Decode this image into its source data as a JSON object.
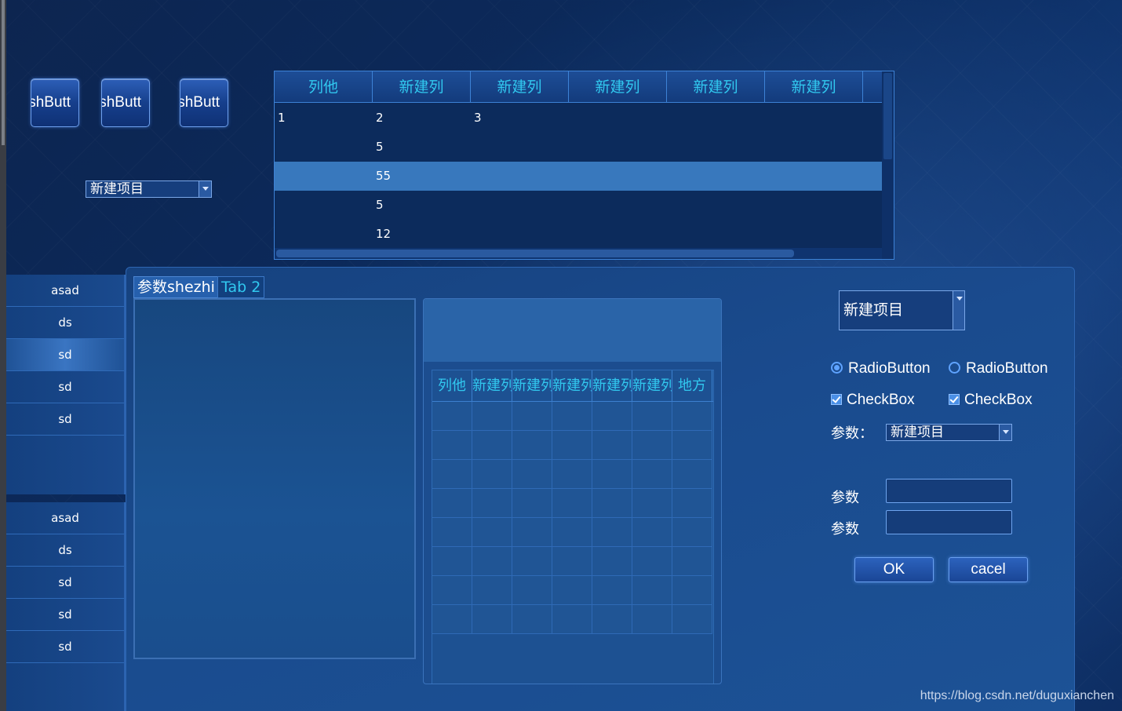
{
  "push_buttons": [
    "ishButt",
    "ishButt",
    "ishButt"
  ],
  "top_combo": {
    "value": "新建项目"
  },
  "top_table": {
    "headers": [
      "列他",
      "新建列",
      "新建列",
      "新建列",
      "新建列",
      "新建列"
    ],
    "rows": [
      [
        "1",
        "2",
        "3"
      ],
      [
        "",
        "5",
        ""
      ],
      [
        "",
        "55",
        ""
      ],
      [
        "",
        "5",
        ""
      ],
      [
        "",
        "12",
        ""
      ]
    ],
    "selected_row": 2
  },
  "nav_top": {
    "items": [
      "asad",
      "ds",
      "sd",
      "sd",
      "sd"
    ],
    "active": 2
  },
  "nav_bottom": {
    "items": [
      "asad",
      "ds",
      "sd",
      "sd",
      "sd"
    ]
  },
  "tabs": [
    "参数shezhi",
    "Tab 2"
  ],
  "grid": {
    "headers": [
      "列他",
      "新建列",
      "新建列",
      "新建列",
      "新建列",
      "新建列",
      "地方"
    ],
    "row_count": 8
  },
  "settings": {
    "combo_value": "新建项目",
    "radio1": "RadioButton",
    "radio2": "RadioButton",
    "check1": "CheckBox",
    "check2": "CheckBox",
    "param_label_colon": "参数：",
    "param_combo_value": "新建项目",
    "param_label1": "参数",
    "param_label2": "参数",
    "ok": "OK",
    "cancel": "cacel"
  },
  "watermark": "https://blog.csdn.net/duguxianchen"
}
